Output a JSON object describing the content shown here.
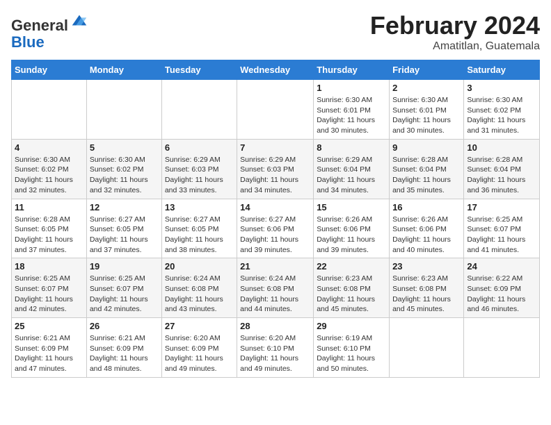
{
  "header": {
    "logo_line1": "General",
    "logo_line2": "Blue",
    "title": "February 2024",
    "subtitle": "Amatitlan, Guatemala"
  },
  "calendar": {
    "days_of_week": [
      "Sunday",
      "Monday",
      "Tuesday",
      "Wednesday",
      "Thursday",
      "Friday",
      "Saturday"
    ],
    "weeks": [
      [
        {
          "day": "",
          "detail": ""
        },
        {
          "day": "",
          "detail": ""
        },
        {
          "day": "",
          "detail": ""
        },
        {
          "day": "",
          "detail": ""
        },
        {
          "day": "1",
          "detail": "Sunrise: 6:30 AM\nSunset: 6:01 PM\nDaylight: 11 hours and 30 minutes."
        },
        {
          "day": "2",
          "detail": "Sunrise: 6:30 AM\nSunset: 6:01 PM\nDaylight: 11 hours and 30 minutes."
        },
        {
          "day": "3",
          "detail": "Sunrise: 6:30 AM\nSunset: 6:02 PM\nDaylight: 11 hours and 31 minutes."
        }
      ],
      [
        {
          "day": "4",
          "detail": "Sunrise: 6:30 AM\nSunset: 6:02 PM\nDaylight: 11 hours and 32 minutes."
        },
        {
          "day": "5",
          "detail": "Sunrise: 6:30 AM\nSunset: 6:02 PM\nDaylight: 11 hours and 32 minutes."
        },
        {
          "day": "6",
          "detail": "Sunrise: 6:29 AM\nSunset: 6:03 PM\nDaylight: 11 hours and 33 minutes."
        },
        {
          "day": "7",
          "detail": "Sunrise: 6:29 AM\nSunset: 6:03 PM\nDaylight: 11 hours and 34 minutes."
        },
        {
          "day": "8",
          "detail": "Sunrise: 6:29 AM\nSunset: 6:04 PM\nDaylight: 11 hours and 34 minutes."
        },
        {
          "day": "9",
          "detail": "Sunrise: 6:28 AM\nSunset: 6:04 PM\nDaylight: 11 hours and 35 minutes."
        },
        {
          "day": "10",
          "detail": "Sunrise: 6:28 AM\nSunset: 6:04 PM\nDaylight: 11 hours and 36 minutes."
        }
      ],
      [
        {
          "day": "11",
          "detail": "Sunrise: 6:28 AM\nSunset: 6:05 PM\nDaylight: 11 hours and 37 minutes."
        },
        {
          "day": "12",
          "detail": "Sunrise: 6:27 AM\nSunset: 6:05 PM\nDaylight: 11 hours and 37 minutes."
        },
        {
          "day": "13",
          "detail": "Sunrise: 6:27 AM\nSunset: 6:05 PM\nDaylight: 11 hours and 38 minutes."
        },
        {
          "day": "14",
          "detail": "Sunrise: 6:27 AM\nSunset: 6:06 PM\nDaylight: 11 hours and 39 minutes."
        },
        {
          "day": "15",
          "detail": "Sunrise: 6:26 AM\nSunset: 6:06 PM\nDaylight: 11 hours and 39 minutes."
        },
        {
          "day": "16",
          "detail": "Sunrise: 6:26 AM\nSunset: 6:06 PM\nDaylight: 11 hours and 40 minutes."
        },
        {
          "day": "17",
          "detail": "Sunrise: 6:25 AM\nSunset: 6:07 PM\nDaylight: 11 hours and 41 minutes."
        }
      ],
      [
        {
          "day": "18",
          "detail": "Sunrise: 6:25 AM\nSunset: 6:07 PM\nDaylight: 11 hours and 42 minutes."
        },
        {
          "day": "19",
          "detail": "Sunrise: 6:25 AM\nSunset: 6:07 PM\nDaylight: 11 hours and 42 minutes."
        },
        {
          "day": "20",
          "detail": "Sunrise: 6:24 AM\nSunset: 6:08 PM\nDaylight: 11 hours and 43 minutes."
        },
        {
          "day": "21",
          "detail": "Sunrise: 6:24 AM\nSunset: 6:08 PM\nDaylight: 11 hours and 44 minutes."
        },
        {
          "day": "22",
          "detail": "Sunrise: 6:23 AM\nSunset: 6:08 PM\nDaylight: 11 hours and 45 minutes."
        },
        {
          "day": "23",
          "detail": "Sunrise: 6:23 AM\nSunset: 6:08 PM\nDaylight: 11 hours and 45 minutes."
        },
        {
          "day": "24",
          "detail": "Sunrise: 6:22 AM\nSunset: 6:09 PM\nDaylight: 11 hours and 46 minutes."
        }
      ],
      [
        {
          "day": "25",
          "detail": "Sunrise: 6:21 AM\nSunset: 6:09 PM\nDaylight: 11 hours and 47 minutes."
        },
        {
          "day": "26",
          "detail": "Sunrise: 6:21 AM\nSunset: 6:09 PM\nDaylight: 11 hours and 48 minutes."
        },
        {
          "day": "27",
          "detail": "Sunrise: 6:20 AM\nSunset: 6:09 PM\nDaylight: 11 hours and 49 minutes."
        },
        {
          "day": "28",
          "detail": "Sunrise: 6:20 AM\nSunset: 6:10 PM\nDaylight: 11 hours and 49 minutes."
        },
        {
          "day": "29",
          "detail": "Sunrise: 6:19 AM\nSunset: 6:10 PM\nDaylight: 11 hours and 50 minutes."
        },
        {
          "day": "",
          "detail": ""
        },
        {
          "day": "",
          "detail": ""
        }
      ]
    ]
  }
}
